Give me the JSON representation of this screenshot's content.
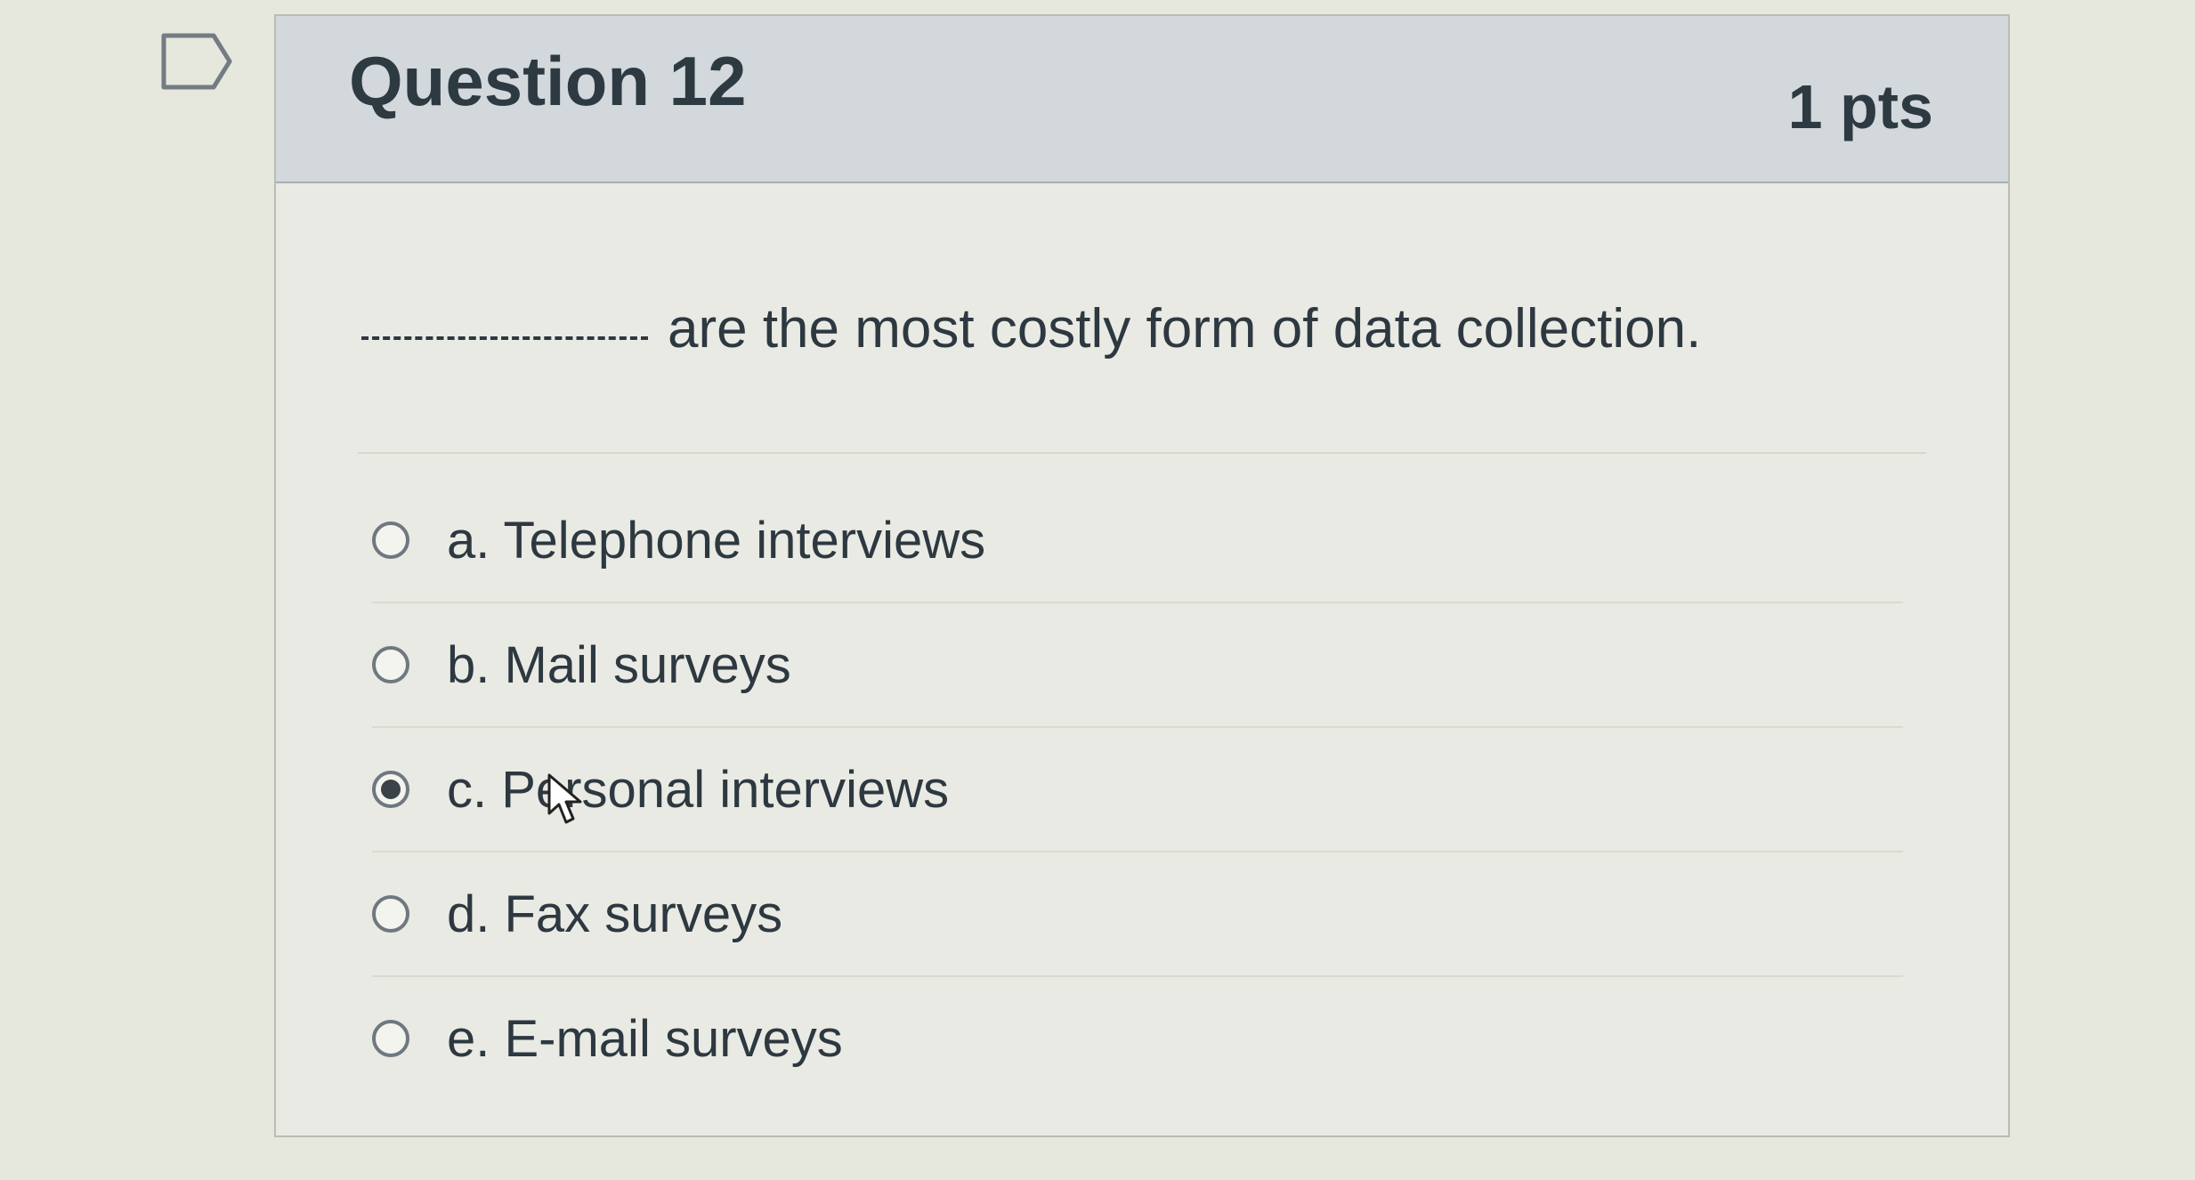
{
  "question": {
    "title": "Question 12",
    "points": "1 pts",
    "prompt": "are the most costly form of data collection.",
    "answers": [
      {
        "label": "a. Telephone interviews",
        "selected": false
      },
      {
        "label": "b. Mail surveys",
        "selected": false
      },
      {
        "label": "c. Personal interviews",
        "selected": true
      },
      {
        "label": "d. Fax surveys",
        "selected": false
      },
      {
        "label": "e. E-mail surveys",
        "selected": false
      }
    ]
  },
  "icons": {
    "flag": "bookmark-flag-icon",
    "cursor": "mouse-pointer-icon"
  },
  "colors": {
    "header_bg": "#d3d8dc",
    "card_bg": "#e9eae3",
    "text": "#2d3840",
    "radio_border": "#6f7880"
  }
}
